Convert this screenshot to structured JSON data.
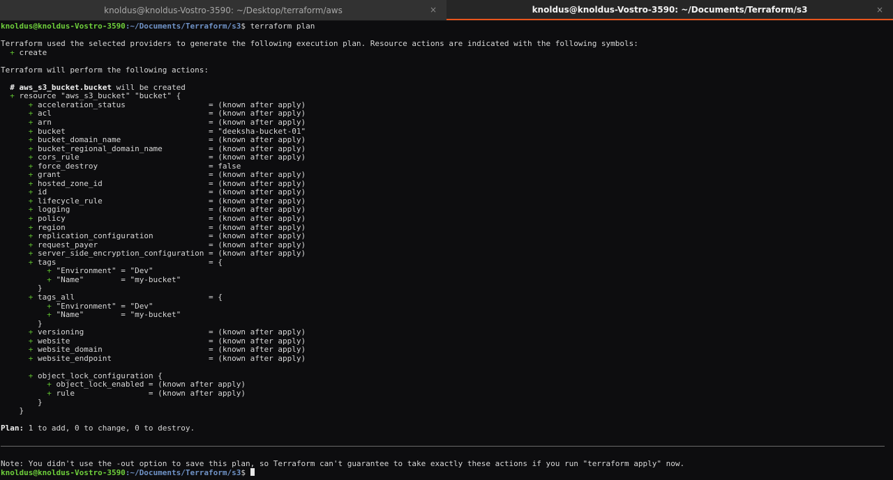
{
  "tabs": [
    {
      "title": "knoldus@knoldus-Vostro-3590: ~/Desktop/terraform/aws",
      "close": "×",
      "active": false
    },
    {
      "title": "knoldus@knoldus-Vostro-3590: ~/Documents/Terraform/s3",
      "close": "×",
      "active": true
    }
  ],
  "prompt": {
    "user": "knoldus@knoldus-Vostro-3590",
    "path": ":~/Documents/Terraform/s3",
    "symbol": "$ "
  },
  "command": "terraform plan",
  "intro": "Terraform used the selected providers to generate the following execution plan. Resource actions are indicated with the following symbols:",
  "legend_symbol": "+",
  "legend_action": "create",
  "actions_header": "Terraform will perform the following actions:",
  "resource_comment_hash": "# ",
  "resource_name": "aws_s3_bucket.bucket",
  "resource_comment_rest": " will be created",
  "resource_decl": "resource \"aws_s3_bucket\" \"bucket\" {",
  "attributes_a": [
    {
      "name": "acceleration_status",
      "value": "(known after apply)"
    },
    {
      "name": "acl",
      "value": "(known after apply)"
    },
    {
      "name": "arn",
      "value": "(known after apply)"
    },
    {
      "name": "bucket",
      "value": "\"deeksha-bucket-01\""
    },
    {
      "name": "bucket_domain_name",
      "value": "(known after apply)"
    },
    {
      "name": "bucket_regional_domain_name",
      "value": "(known after apply)"
    },
    {
      "name": "cors_rule",
      "value": "(known after apply)"
    },
    {
      "name": "force_destroy",
      "value": "false"
    },
    {
      "name": "grant",
      "value": "(known after apply)"
    },
    {
      "name": "hosted_zone_id",
      "value": "(known after apply)"
    },
    {
      "name": "id",
      "value": "(known after apply)"
    },
    {
      "name": "lifecycle_rule",
      "value": "(known after apply)"
    },
    {
      "name": "logging",
      "value": "(known after apply)"
    },
    {
      "name": "policy",
      "value": "(known after apply)"
    },
    {
      "name": "region",
      "value": "(known after apply)"
    },
    {
      "name": "replication_configuration",
      "value": "(known after apply)"
    },
    {
      "name": "request_payer",
      "value": "(known after apply)"
    },
    {
      "name": "server_side_encryption_configuration",
      "value": "(known after apply)"
    }
  ],
  "tags_block": {
    "name": "tags",
    "open": "{",
    "items": [
      {
        "key": "\"Environment\"",
        "value": "\"Dev\""
      },
      {
        "key": "\"Name\"",
        "value": "\"my-bucket\""
      }
    ],
    "close": "}"
  },
  "tags_all_block": {
    "name": "tags_all",
    "open": "{",
    "items": [
      {
        "key": "\"Environment\"",
        "value": "\"Dev\""
      },
      {
        "key": "\"Name\"",
        "value": "\"my-bucket\""
      }
    ],
    "close": "}"
  },
  "attributes_b": [
    {
      "name": "versioning",
      "value": "(known after apply)"
    },
    {
      "name": "website",
      "value": "(known after apply)"
    },
    {
      "name": "website_domain",
      "value": "(known after apply)"
    },
    {
      "name": "website_endpoint",
      "value": "(known after apply)"
    }
  ],
  "object_lock": {
    "header": "object_lock_configuration {",
    "items": [
      {
        "name": "object_lock_enabled",
        "value": "(known after apply)"
      },
      {
        "name": "rule",
        "value": "(known after apply)"
      }
    ],
    "close": "}"
  },
  "resource_close": "}",
  "plan_label": "Plan:",
  "plan_summary": " 1 to add, 0 to change, 0 to destroy.",
  "note": "Note: You didn't use the -out option to save this plan, so Terraform can't guarantee to take exactly these actions if you run \"terraform apply\" now."
}
